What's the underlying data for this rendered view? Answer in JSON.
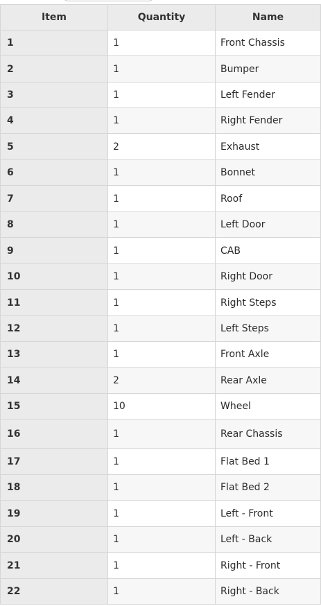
{
  "table": {
    "columns": [
      "Item",
      "Quantity",
      "Name"
    ],
    "rows": [
      {
        "item": "1",
        "quantity": "1",
        "name": "Front Chassis"
      },
      {
        "item": "2",
        "quantity": "1",
        "name": "Bumper"
      },
      {
        "item": "3",
        "quantity": "1",
        "name": "Left Fender"
      },
      {
        "item": "4",
        "quantity": "1",
        "name": "Right Fender"
      },
      {
        "item": "5",
        "quantity": "2",
        "name": "Exhaust"
      },
      {
        "item": "6",
        "quantity": "1",
        "name": "Bonnet"
      },
      {
        "item": "7",
        "quantity": "1",
        "name": "Roof"
      },
      {
        "item": "8",
        "quantity": "1",
        "name": "Left Door"
      },
      {
        "item": "9",
        "quantity": "1",
        "name": "CAB"
      },
      {
        "item": "10",
        "quantity": "1",
        "name": "Right Door"
      },
      {
        "item": "11",
        "quantity": "1",
        "name": "Right Steps"
      },
      {
        "item": "12",
        "quantity": "1",
        "name": "Left Steps"
      },
      {
        "item": "13",
        "quantity": "1",
        "name": "Front Axle"
      },
      {
        "item": "14",
        "quantity": "2",
        "name": "Rear Axle"
      },
      {
        "item": "15",
        "quantity": "10",
        "name": "Wheel"
      },
      {
        "item": "16",
        "quantity": "1",
        "name": "Rear Chassis"
      },
      {
        "item": "17",
        "quantity": "1",
        "name": "Flat Bed 1"
      },
      {
        "item": "18",
        "quantity": "1",
        "name": "Flat Bed 2"
      },
      {
        "item": "19",
        "quantity": "1",
        "name": "Left - Front"
      },
      {
        "item": "20",
        "quantity": "1",
        "name": "Left - Back"
      },
      {
        "item": "21",
        "quantity": "1",
        "name": "Right - Front"
      },
      {
        "item": "22",
        "quantity": "1",
        "name": "Right - Back"
      }
    ]
  }
}
